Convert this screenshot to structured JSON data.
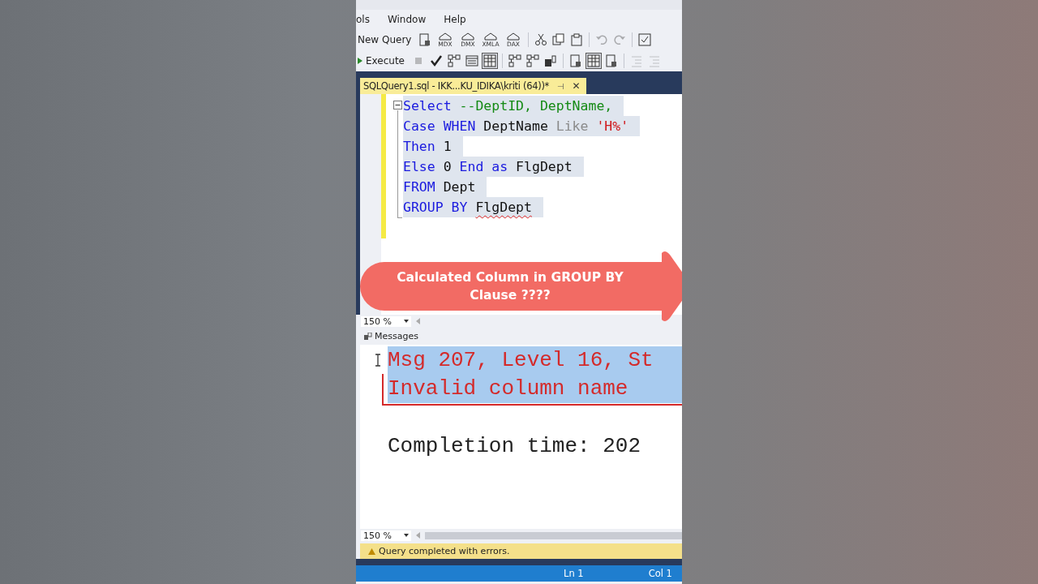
{
  "menu": [
    "ols",
    "Window",
    "Help"
  ],
  "toolbar_1": [
    {
      "kind": "button",
      "label": "New Query"
    },
    {
      "kind": "icon"
    },
    {
      "kind": "labeled_icon",
      "label": "MDX"
    },
    {
      "kind": "labeled_icon",
      "label": "DMX"
    },
    {
      "kind": "labeled_icon",
      "label": "XMLA"
    },
    {
      "kind": "labeled_icon",
      "label": "DAX"
    },
    {
      "kind": "sep"
    },
    {
      "kind": "icon"
    },
    {
      "kind": "icon"
    },
    {
      "kind": "icon"
    },
    {
      "kind": "sep"
    },
    {
      "kind": "icon",
      "disabled": true
    },
    {
      "kind": "icon",
      "disabled": true
    },
    {
      "kind": "sep"
    },
    {
      "kind": "icon"
    }
  ],
  "toolbar_2": [
    {
      "kind": "button",
      "label": "Execute"
    },
    {
      "kind": "icon",
      "disabled": true
    },
    {
      "kind": "icon"
    },
    {
      "kind": "icon"
    },
    {
      "kind": "icon"
    },
    {
      "kind": "icon",
      "selected": true
    },
    {
      "kind": "sep"
    },
    {
      "kind": "icon"
    },
    {
      "kind": "icon"
    },
    {
      "kind": "icon"
    },
    {
      "kind": "sep"
    },
    {
      "kind": "icon"
    },
    {
      "kind": "icon",
      "selected": true
    },
    {
      "kind": "icon"
    },
    {
      "kind": "sep"
    },
    {
      "kind": "icon",
      "disabled": true
    },
    {
      "kind": "icon",
      "disabled": true
    }
  ],
  "tab": {
    "title": "SQLQuery1.sql - IKK...KU_IDIKA\\kriti (64))*",
    "pin": "⊣",
    "close": "✕"
  },
  "code": [
    [
      {
        "kind": "keyword",
        "text": "Select "
      },
      {
        "kind": "comment",
        "text": "--DeptID, DeptName,"
      }
    ],
    [
      {
        "kind": "keyword",
        "text": "Case WHEN "
      },
      {
        "kind": "plain",
        "text": "DeptName "
      },
      {
        "kind": "operator",
        "text": "Like "
      },
      {
        "kind": "string",
        "text": "'H%'"
      }
    ],
    [
      {
        "kind": "keyword",
        "text": "Then "
      },
      {
        "kind": "plain",
        "text": "1"
      }
    ],
    [
      {
        "kind": "keyword",
        "text": "Else "
      },
      {
        "kind": "plain",
        "text": "0 "
      },
      {
        "kind": "keyword",
        "text": "End as "
      },
      {
        "kind": "plain",
        "text": "FlgDept"
      }
    ],
    [
      {
        "kind": "keyword",
        "text": "FROM "
      },
      {
        "kind": "plain",
        "text": "Dept"
      }
    ],
    [
      {
        "kind": "keyword",
        "text": "GROUP BY "
      },
      {
        "kind": "plain",
        "text": "FlgDept",
        "error": true
      }
    ]
  ],
  "banner": {
    "text": "Calculated Column in GROUP BY Clause ????"
  },
  "editor_zoom": "150 %",
  "results_tab": "Messages",
  "messages": [
    {
      "kind": "error",
      "text": "Msg 207, Level 16, St"
    },
    {
      "kind": "error",
      "text": "Invalid column name"
    },
    {
      "kind": "info",
      "text": "Completion time: 202"
    }
  ],
  "results_zoom": "150 %",
  "query_status": {
    "text": "Query completed with errors.",
    "warning": true
  },
  "status_bar": {
    "line": "Ln 1",
    "column": "Col 1"
  }
}
